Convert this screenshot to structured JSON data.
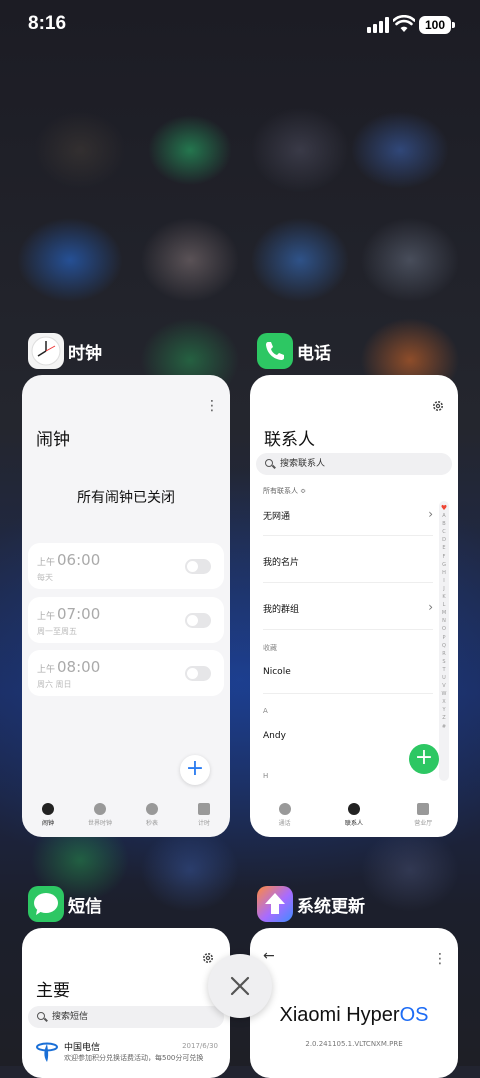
{
  "status_bar": {
    "time": "8:16",
    "battery": "100",
    "icons": [
      "signal-icon",
      "wifi-icon",
      "battery-icon"
    ]
  },
  "apps": {
    "clock": {
      "name": "时钟",
      "title": "闹钟",
      "all_closed": "所有闹钟已关闭",
      "alarms": [
        {
          "ampm": "上午",
          "time": "06:00",
          "repeat": "每天",
          "enabled": false
        },
        {
          "ampm": "上午",
          "time": "07:00",
          "repeat": "周一至周五",
          "enabled": false
        },
        {
          "ampm": "上午",
          "time": "08:00",
          "repeat": "周六 周日",
          "enabled": false
        }
      ],
      "add_button": "+",
      "tabs": [
        "闹钟",
        "世界时钟",
        "秒表",
        "计时"
      ]
    },
    "phone": {
      "name": "电话",
      "title": "联系人",
      "search_placeholder": "搜索联系人",
      "all_contacts": "所有联系人 ≎",
      "rows": [
        "无网通",
        "我的名片",
        "我的群组"
      ],
      "section_fav": "收藏",
      "fav_contact": "Nicole",
      "section_a": "A",
      "contact_a": "Andy",
      "section_h": "H",
      "index_letters": [
        "A",
        "B",
        "C",
        "D",
        "E",
        "F",
        "G",
        "H",
        "I",
        "J",
        "K",
        "L",
        "M",
        "N",
        "O",
        "P",
        "Q",
        "R",
        "S",
        "T",
        "U",
        "V",
        "W",
        "X",
        "Y",
        "Z",
        "#"
      ],
      "add_button": "+",
      "tabs": [
        "通话",
        "联系人",
        "营业厅"
      ]
    },
    "messages": {
      "name": "短信",
      "title": "主要",
      "search_placeholder": "搜索短信",
      "message": {
        "sender": "中国电信",
        "date": "2017/6/30",
        "preview": "欢迎参加积分兑换话费活动，每500分可兑换"
      }
    },
    "update": {
      "name": "系统更新",
      "title_part1": "Xiaomi Hyper",
      "title_part2": "OS",
      "version": "2.0.241105.1.VLTCNXM.PRE",
      "back": "←"
    }
  },
  "close_all": "×"
}
